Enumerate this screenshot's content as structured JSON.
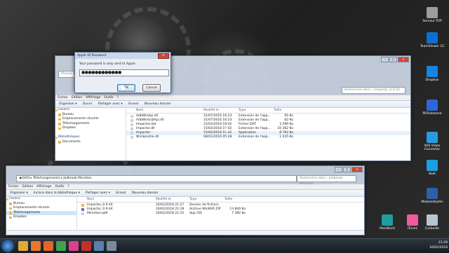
{
  "desktop_icons": [
    {
      "label": "Serveur P2P",
      "icon": "server-icon",
      "color": "#9c9c9c"
    },
    {
      "label": "TeamViewer 12",
      "icon": "teamviewer-icon",
      "color": "#0e6fd1"
    },
    {
      "label": "Dropbox",
      "icon": "dropbox-icon",
      "color": "#1a82e2"
    },
    {
      "label": "PDFelement",
      "icon": "pdf-icon",
      "color": "#2f65d9"
    },
    {
      "label": "AVS Video Converter",
      "icon": "video-icon",
      "color": "#2a9adf"
    },
    {
      "label": "Kodi",
      "icon": "kodi-icon",
      "color": "#1aa0e0"
    },
    {
      "label": "Malwarebytes",
      "icon": "malwarebytes-icon",
      "color": "#2e5fa8"
    },
    {
      "label": "Corbeille",
      "icon": "trash-icon",
      "color": "#b9c4cf"
    }
  ],
  "desktop_icons_row": [
    {
      "label": "PeerBlock",
      "icon": "shield-icon",
      "color": "#1e9ea0"
    },
    {
      "label": "iTunes",
      "icon": "itunes-icon",
      "color": "#f05a9a"
    }
  ],
  "dialog": {
    "title": "Apple ID Password",
    "close_label": "✕",
    "message": "Your password is only sent to Apple.",
    "password_mask": "●●●●●●●●●●●●",
    "ok_label": "OK",
    "cancel_label": "Cancel"
  },
  "win1": {
    "partial_field": "iPhone d",
    "search_placeholder": "Rechercher dans : Impactor_0.9.44",
    "menu": [
      "Fichier",
      "Edition",
      "Affichage",
      "Outils",
      "?"
    ],
    "toolbar": [
      "Organiser ▾",
      "Ouvrir",
      "Partager avec ▾",
      "Graver",
      "Nouveau dossier"
    ],
    "nav": [
      {
        "label": "Favoris",
        "header": true
      },
      {
        "label": "Bureau"
      },
      {
        "label": "Emplacements récents"
      },
      {
        "label": "Téléchargements"
      },
      {
        "label": "Dropbox"
      },
      {
        "label": "",
        "spacer": true
      },
      {
        "label": "Bibliothèques",
        "header": true
      },
      {
        "label": "Documents"
      }
    ],
    "columns": [
      "Nom",
      "Modifié le",
      "Type",
      "Taille"
    ],
    "rows": [
      {
        "name": "AdbWinApi.dll",
        "date": "31/07/2016 16:23",
        "type": "Extension de l'app...",
        "size": "95 Ko"
      },
      {
        "name": "AdbWinUsbApi.dll",
        "date": "31/07/2016 16:23",
        "type": "Extension de l'app...",
        "size": "62 Ko"
      },
      {
        "name": "Impactor.dat",
        "date": "15/02/2018 19:42",
        "type": "Fichier DAT",
        "size": "3 299 Ko"
      },
      {
        "name": "Impactor.dll",
        "date": "15/02/2018 19:42",
        "type": "Extension de l'app...",
        "size": "10 382 Ko"
      },
      {
        "name": "Impactor",
        "date": "15/02/2018 19:42",
        "type": "Application",
        "size": "8 792 Ko"
      },
      {
        "name": "WinSparkle.dll",
        "date": "08/01/2016 05:28",
        "type": "Extension de l'app...",
        "size": "1 035 Ko"
      }
    ]
  },
  "win2": {
    "breadcrumb": "◀ DAD ▸ Téléchargements ▸ Jailbreak Meridian",
    "search_placeholder": "Rechercher dans : Jailbreak Meridian",
    "menu": [
      "Fichier",
      "Edition",
      "Affichage",
      "Outils",
      "?"
    ],
    "toolbar": [
      "Organiser ▾",
      "Inclure dans la bibliothèque ▾",
      "Partager avec ▾",
      "Graver",
      "Nouveau dossier"
    ],
    "nav": [
      {
        "label": "Favoris",
        "header": true
      },
      {
        "label": "Bureau"
      },
      {
        "label": "Emplacements récents"
      },
      {
        "label": "Téléchargements",
        "selected": true
      },
      {
        "label": "Dropbox"
      }
    ],
    "columns": [
      "Nom",
      "Modifié le",
      "Type",
      "Taille"
    ],
    "rows": [
      {
        "name": "Impactor_0.9.44",
        "date": "16/02/2018 21:27",
        "type": "Dossier de fichiers",
        "size": ""
      },
      {
        "name": "Impactor_0.9.44",
        "date": "16/02/2018 21:28",
        "type": "Archive WinRAR ZIP",
        "size": "13 840 Ko"
      },
      {
        "name": "Meridian-pb6",
        "date": "16/02/2018 21:25",
        "type": "App iOS",
        "size": "7 382 Ko"
      }
    ]
  },
  "taskbar": {
    "time": "21:29",
    "date": "16/02/2018",
    "apps": [
      {
        "icon": "explorer-icon",
        "color": "#e0a93a"
      },
      {
        "icon": "media-player-icon",
        "color": "#e8792b"
      },
      {
        "icon": "firefox-icon",
        "color": "#e2662a"
      },
      {
        "icon": "chrome-icon",
        "color": "#3fa34d"
      },
      {
        "icon": "itunes-icon",
        "color": "#d8418c"
      },
      {
        "icon": "pdf-icon",
        "color": "#c4302b"
      },
      {
        "icon": "app-icon",
        "color": "#5a7fb0"
      },
      {
        "icon": "app-icon",
        "color": "#7a8a9c"
      }
    ]
  }
}
